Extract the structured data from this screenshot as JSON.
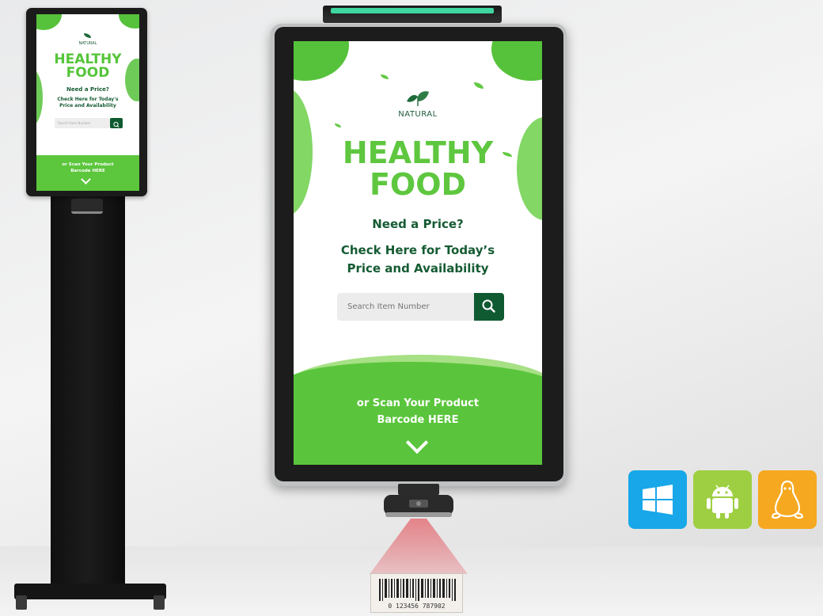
{
  "small_kiosk": {
    "brand": "NATURAL",
    "title_line1": "HEALTHY",
    "title_line2": "FOOD",
    "question": "Need a Price?",
    "subtitle_line1": "Check Here for Today's",
    "subtitle_line2": "Price and Availability",
    "search_placeholder": "Search Item Number",
    "scan_line1": "or Scan Your Product",
    "scan_line2": "Barcode HERE"
  },
  "large_kiosk": {
    "brand": "NATURAL",
    "title_line1": "HEALTHY",
    "title_line2": "FOOD",
    "question": "Need a Price?",
    "subtitle_line1": "Check Here for Today’s",
    "subtitle_line2": "Price and Availability",
    "search_placeholder": "Search Item Number",
    "scan_line1": "or Scan Your Product",
    "scan_line2": "Barcode HERE"
  },
  "barcode": {
    "digits": "0  123456   787902"
  },
  "os_badges": [
    {
      "name": "windows-icon",
      "color": "#18a7e8"
    },
    {
      "name": "android-icon",
      "color": "#9ecf42"
    },
    {
      "name": "linux-icon",
      "color": "#f6a820"
    }
  ],
  "colors": {
    "brand_green": "#5ec73f",
    "dark_green": "#155b33",
    "button_green": "#0f5a31"
  }
}
